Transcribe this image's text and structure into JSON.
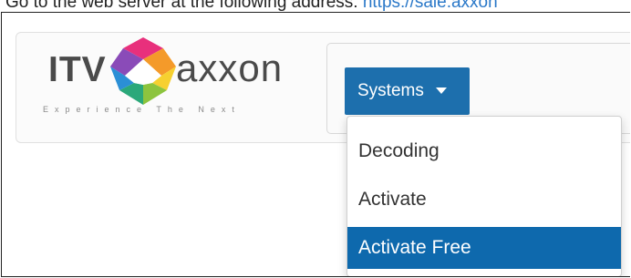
{
  "instruction": {
    "text": "Go to the web server at the following address:",
    "link_text": "https://sale.axxon"
  },
  "logo": {
    "brand_left": "ITV",
    "brand_right": "axxon",
    "tagline": "Experience The Next"
  },
  "nav": {
    "systems_label": "Systems"
  },
  "dropdown": {
    "items": [
      {
        "label": "Decoding",
        "active": false
      },
      {
        "label": "Activate",
        "active": false
      },
      {
        "label": "Activate Free",
        "active": true
      }
    ]
  },
  "colors": {
    "accent": "#1d6fad",
    "active_item": "#0e69ad",
    "link": "#2a78c8"
  }
}
